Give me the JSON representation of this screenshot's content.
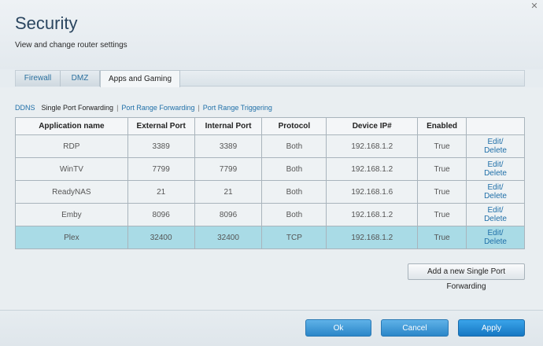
{
  "header": {
    "title": "Security",
    "subtitle": "View and change router settings",
    "close_glyph": "✕"
  },
  "tabs": [
    {
      "label": "Firewall"
    },
    {
      "label": "DMZ"
    },
    {
      "label": "Apps and Gaming"
    }
  ],
  "subnav": [
    {
      "label": "DDNS"
    },
    {
      "label": "Single Port Forwarding"
    },
    {
      "label": "Port Range Forwarding"
    },
    {
      "label": "Port Range Triggering"
    }
  ],
  "table": {
    "columns": [
      "Application name",
      "External Port",
      "Internal Port",
      "Protocol",
      "Device IP#",
      "Enabled",
      ""
    ],
    "rows": [
      {
        "app": "RDP",
        "ext": "3389",
        "int": "3389",
        "proto": "Both",
        "ip": "192.168.1.2",
        "enabled": "True",
        "edit": "Edit/",
        "del": "Delete"
      },
      {
        "app": "WinTV",
        "ext": "7799",
        "int": "7799",
        "proto": "Both",
        "ip": "192.168.1.2",
        "enabled": "True",
        "edit": "Edit/",
        "del": "Delete"
      },
      {
        "app": "ReadyNAS",
        "ext": "21",
        "int": "21",
        "proto": "Both",
        "ip": "192.168.1.6",
        "enabled": "True",
        "edit": "Edit/",
        "del": "Delete"
      },
      {
        "app": "Emby",
        "ext": "8096",
        "int": "8096",
        "proto": "Both",
        "ip": "192.168.1.2",
        "enabled": "True",
        "edit": "Edit/",
        "del": "Delete"
      },
      {
        "app": "Plex",
        "ext": "32400",
        "int": "32400",
        "proto": "TCP",
        "ip": "192.168.1.2",
        "enabled": "True",
        "edit": "Edit/",
        "del": "Delete"
      }
    ]
  },
  "add_button": "Add a new Single Port Forwarding",
  "footer": {
    "ok": "Ok",
    "cancel": "Cancel",
    "apply": "Apply"
  },
  "colors": {
    "accent": "#2b86c8",
    "link": "#1f6fa8",
    "selected_row": "#a9dbe6"
  }
}
